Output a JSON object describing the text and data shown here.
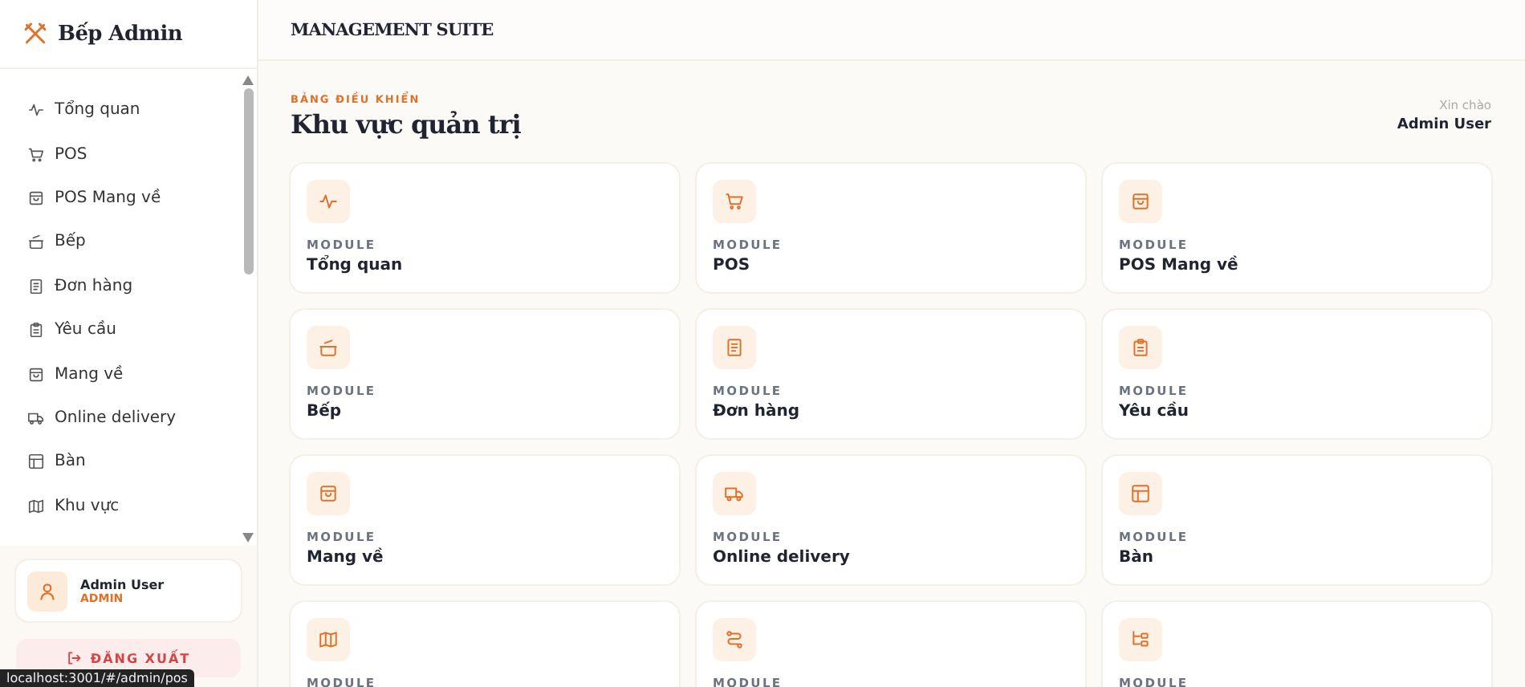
{
  "sidebar": {
    "brand": "Bếp Admin",
    "nav_items": [
      {
        "label": "Tổng quan"
      },
      {
        "label": "POS"
      },
      {
        "label": "POS Mang về"
      },
      {
        "label": "Bếp"
      },
      {
        "label": "Đơn hàng"
      },
      {
        "label": "Yêu cầu"
      },
      {
        "label": "Mang về"
      },
      {
        "label": "Online delivery"
      },
      {
        "label": "Bàn"
      },
      {
        "label": "Khu vực"
      }
    ],
    "user": {
      "name": "Admin User",
      "role": "ADMIN"
    },
    "logout_button": "ĐĂNG XUẤT"
  },
  "header": {
    "title": "MANAGEMENT SUITE"
  },
  "page": {
    "eyebrow": "BẢNG ĐIỀU KHIỂN",
    "title": "Khu vực quản trị",
    "greeting": "Xin chào",
    "user_name": "Admin User"
  },
  "modules": [
    {
      "label": "MODULE",
      "title": "Tổng quan"
    },
    {
      "label": "MODULE",
      "title": "POS"
    },
    {
      "label": "MODULE",
      "title": "POS Mang về"
    },
    {
      "label": "MODULE",
      "title": "Bếp"
    },
    {
      "label": "MODULE",
      "title": "Đơn hàng"
    },
    {
      "label": "MODULE",
      "title": "Yêu cầu"
    },
    {
      "label": "MODULE",
      "title": "Mang về"
    },
    {
      "label": "MODULE",
      "title": "Online delivery"
    },
    {
      "label": "MODULE",
      "title": "Bàn"
    },
    {
      "label": "MODULE"
    },
    {
      "label": "MODULE"
    },
    {
      "label": "MODULE"
    }
  ],
  "status_url": "localhost:3001/#/admin/pos"
}
